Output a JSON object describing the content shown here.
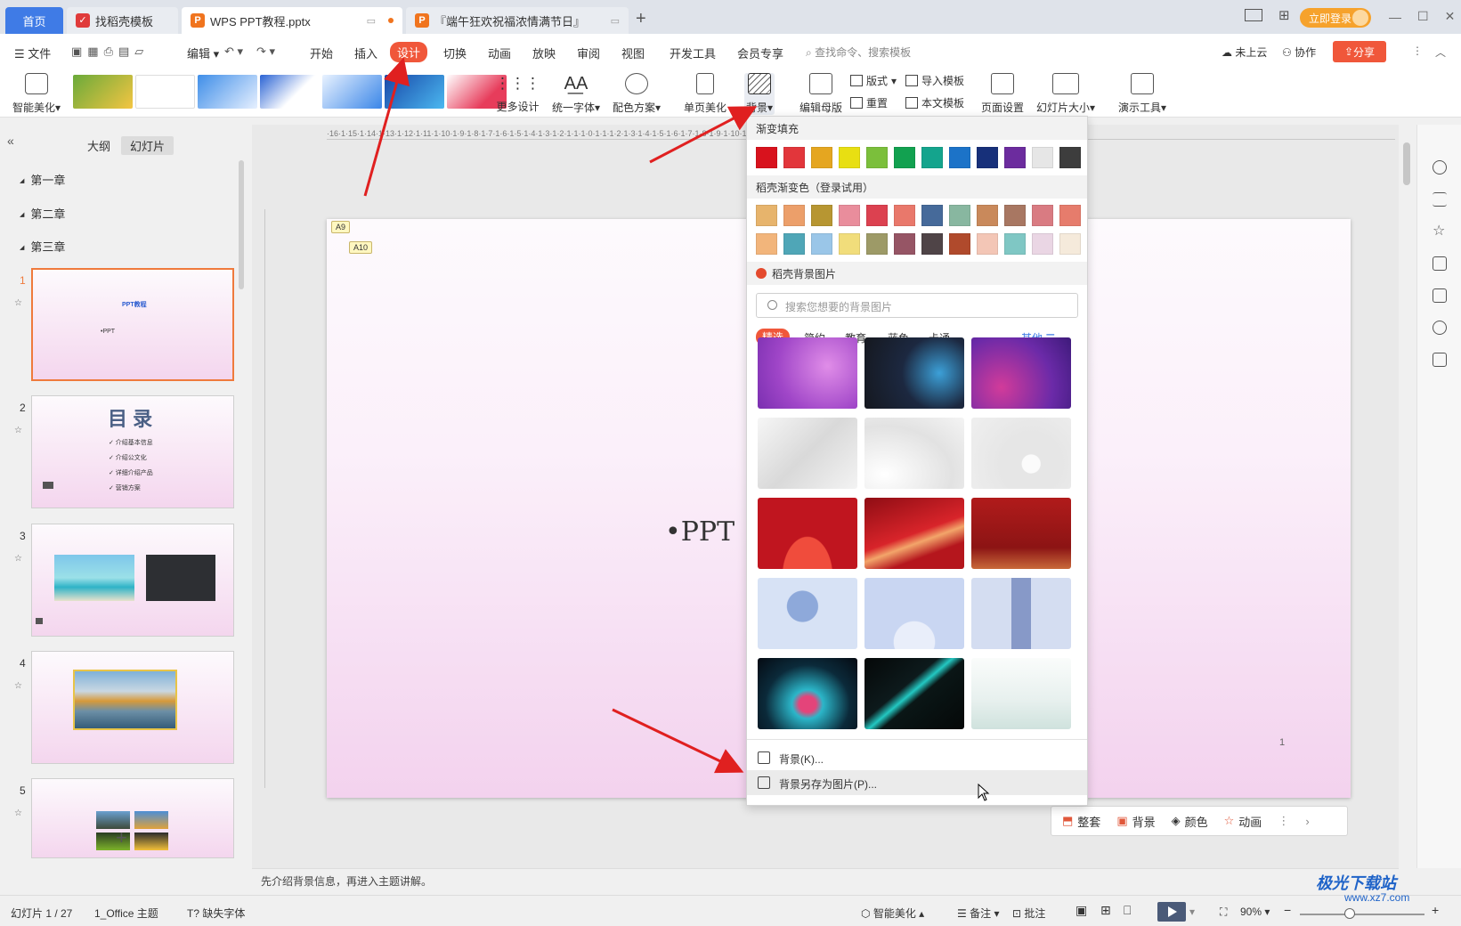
{
  "tabs": {
    "home": "首页",
    "t1": "找稻壳模板",
    "t2": "WPS PPT教程.pptx",
    "t3": "『端午狂欢祝福浓情满节日』",
    "login": "立即登录"
  },
  "menu": {
    "file": "文件",
    "edit": "编辑",
    "items": [
      "开始",
      "插入",
      "设计",
      "切换",
      "动画",
      "放映",
      "审阅",
      "视图",
      "开发工具",
      "会员专享"
    ],
    "search": "查找命令、搜索模板",
    "cloud": "未上云",
    "collab": "协作",
    "share": "分享"
  },
  "ribbon": {
    "beautify": "智能美化",
    "more_design": "更多设计",
    "unify_font": "统一字体",
    "color_scheme": "配色方案",
    "single_beautify": "单页美化",
    "background": "背景",
    "edit_master": "编辑母版",
    "layout": "版式",
    "reset": "重置",
    "import_tpl": "导入模板",
    "this_tpl": "本文模板",
    "page_setup": "页面设置",
    "slide_size": "幻灯片大小",
    "present_tools": "演示工具"
  },
  "left_panel": {
    "tab_outline": "大纲",
    "tab_slides": "幻灯片",
    "chapters": [
      "第一章",
      "第二章",
      "第三章"
    ],
    "slide_numbers": [
      "1",
      "2",
      "3",
      "4",
      "5"
    ],
    "s1_title": "PPT教程",
    "s1_bullet": "•PPT",
    "s2_title": "目 录",
    "s2_items": [
      "✓ 介绍基本信息",
      "✓ 介绍公文化",
      "✓ 详细介绍产品",
      "✓ 营销方案"
    ]
  },
  "slide": {
    "tag_a9": "A9",
    "tag_a10": "A10",
    "bullet": "•PPT",
    "page_number": "1"
  },
  "ruler_text": "·16·1·15·1·14·1·13·1·12·1·11·1·10·1·9·1·8·1·7·1·6·1·5·1·4·1·3·1·2·1·1·1·0·1·1·1·2·1·3·1·4·1·5·1·6·1·7·1·8·1·9·1·10·1·11·1·12·1·13·1·14·1·15·1·16·",
  "bg_panel": {
    "gradient_fill": "渐变填充",
    "docer_gradient": "稻壳渐变色（登录试用）",
    "docer_images": "稻壳背景图片",
    "search_placeholder": "搜索您想要的背景图片",
    "categories": [
      "精选",
      "简约",
      "教育",
      "蓝色",
      "卡通"
    ],
    "other": "其他",
    "menu_background": "背景(K)...",
    "menu_save_as": "背景另存为图片(P)...",
    "gradient_colors": [
      "#d8121d",
      "#e2363b",
      "#e5a620",
      "#e8df12",
      "#7bbf3b",
      "#12a150",
      "#14a48d",
      "#1c73c8",
      "#17307a",
      "#6c2c9e",
      "#e6e6e6",
      "#3d3d3d"
    ],
    "docer_row1": [
      "#e7b46c",
      "#ec9f6a",
      "#b79632",
      "#e98d9c",
      "#dc4150",
      "#e9786b",
      "#466a9a",
      "#88b7a0",
      "#c9895b",
      "#a87762",
      "#d97b82",
      "#e67c6c"
    ],
    "docer_row2": [
      "#f2b57b",
      "#4fa6b7",
      "#9ac6e8",
      "#f1dd7b",
      "#9d9a67",
      "#965565",
      "#4f4447",
      "#b04a2c",
      "#f3c6b6",
      "#7fc7c4",
      "#ead6e4",
      "#f5eadb"
    ]
  },
  "float_toolbar": {
    "neat": "整套",
    "background": "背景",
    "color": "颜色",
    "animation": "动画"
  },
  "notes": "先介绍背景信息，再进入主题讲解。",
  "status": {
    "slide_count": "幻灯片 1 / 27",
    "theme": "1_Office 主题",
    "missing_font": "缺失字体",
    "beautify": "智能美化",
    "notes": "备注",
    "comments": "批注",
    "zoom": "90%"
  },
  "watermark": {
    "name": "极光下载站",
    "url": "www.xz7.com"
  }
}
